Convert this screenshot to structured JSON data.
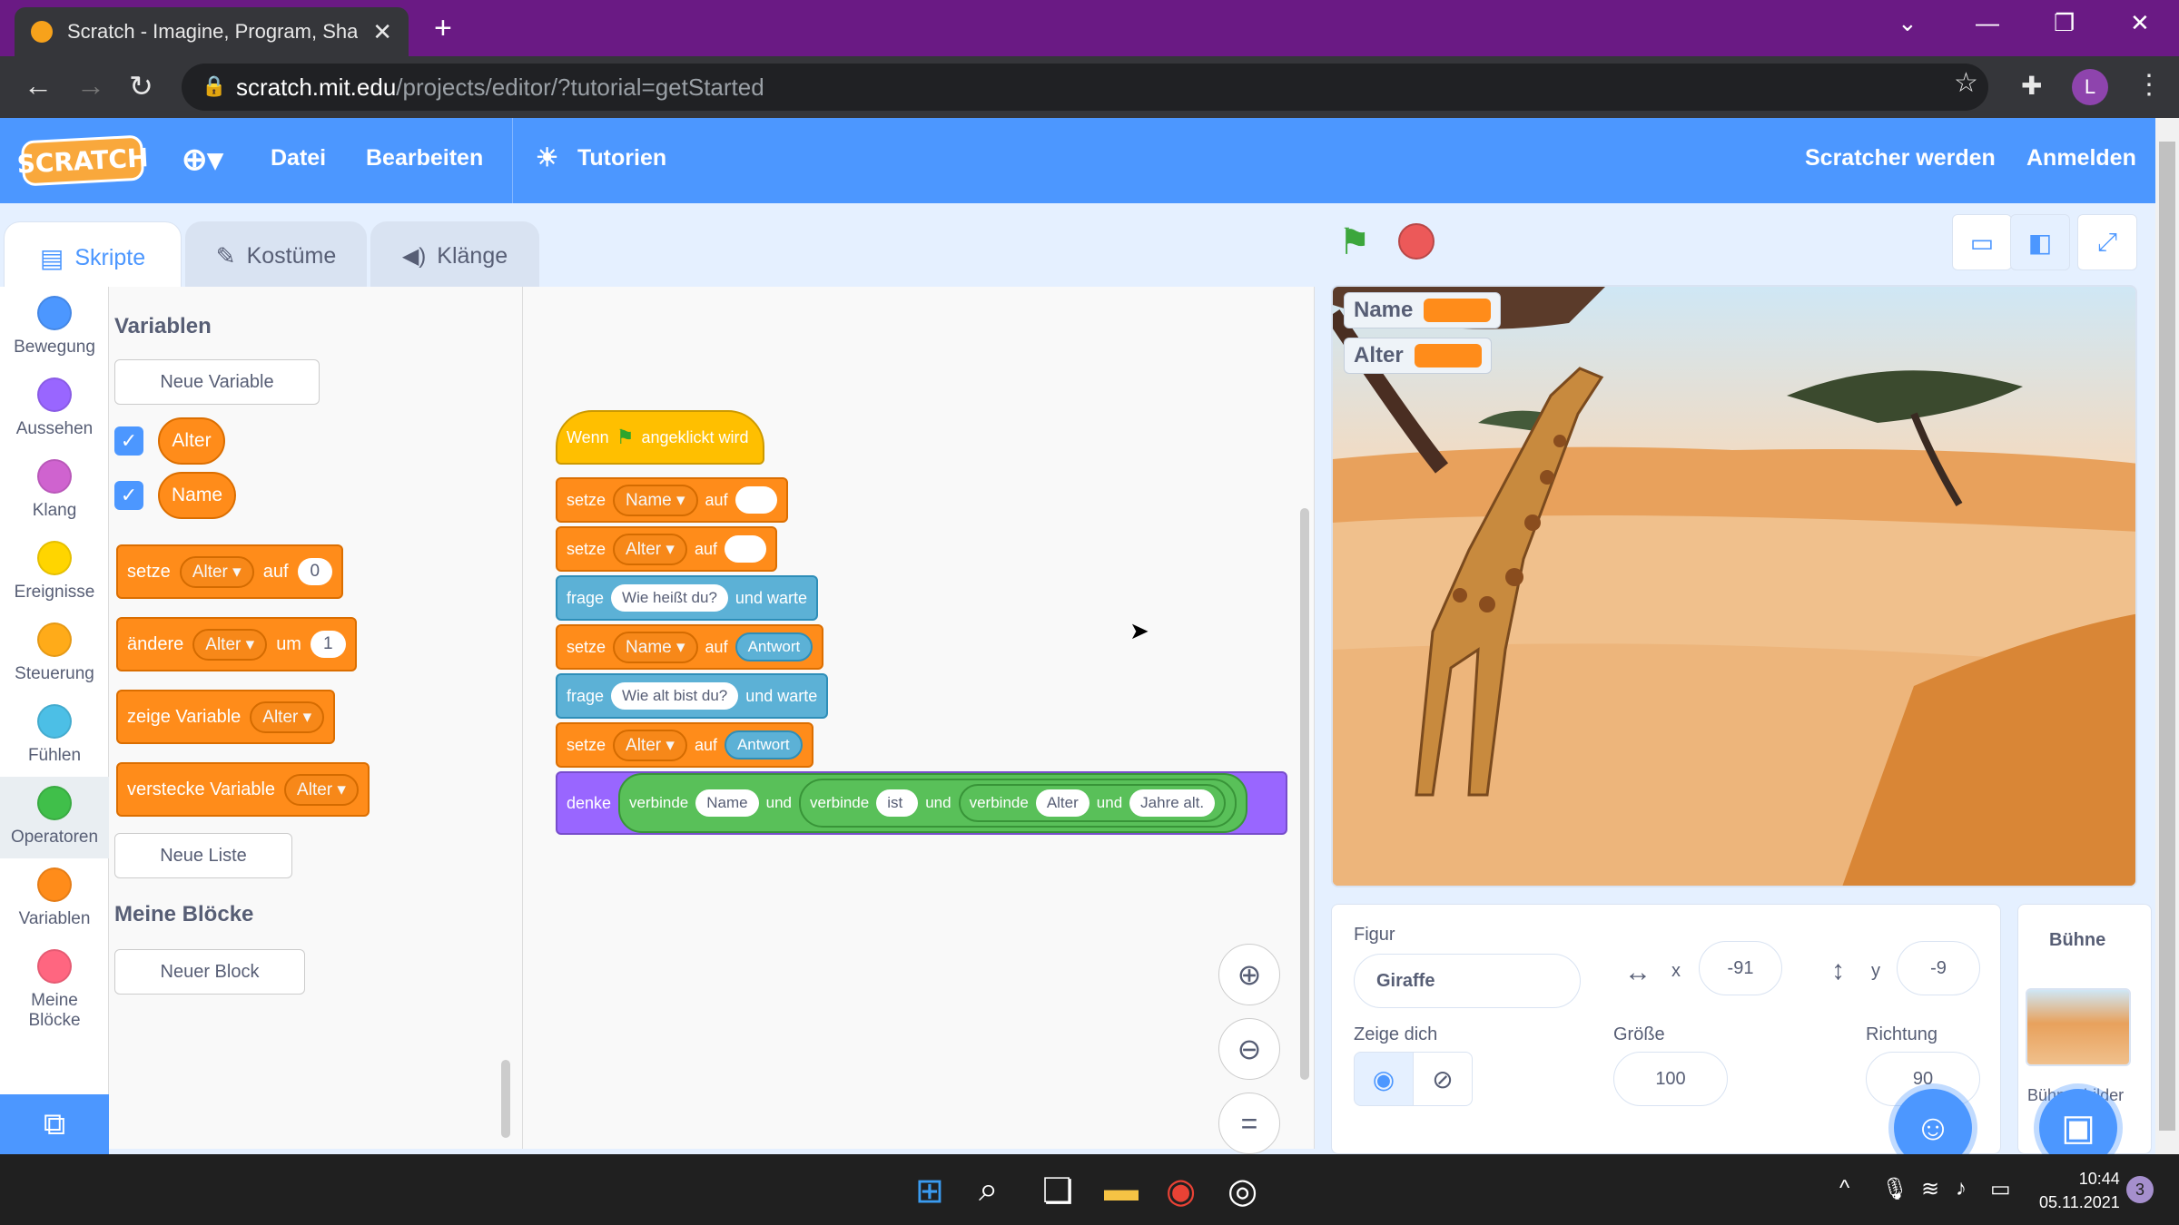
{
  "browser": {
    "tab_title": "Scratch - Imagine, Program, Shar",
    "tab_close": "✕",
    "new_tab": "+",
    "url_host": "scratch.mit.edu",
    "url_path": "/projects/editor/?tutorial=getStarted",
    "profile_initial": "L"
  },
  "menubar": {
    "logo": "SCRATCH",
    "file": "Datei",
    "edit": "Bearbeiten",
    "tutorials": "Tutorien",
    "join": "Scratcher werden",
    "signin": "Anmelden"
  },
  "editor_tabs": [
    "Skripte",
    "Kostüme",
    "Klänge"
  ],
  "categories": [
    {
      "label": "Bewegung",
      "color": "#4c97ff"
    },
    {
      "label": "Aussehen",
      "color": "#9966ff"
    },
    {
      "label": "Klang",
      "color": "#cf63cf"
    },
    {
      "label": "Ereignisse",
      "color": "#ffd500"
    },
    {
      "label": "Steuerung",
      "color": "#ffab19"
    },
    {
      "label": "Fühlen",
      "color": "#4cbfe6"
    },
    {
      "label": "Operatoren",
      "color": "#40bf4a"
    },
    {
      "label": "Variablen",
      "color": "#ff8c1a"
    },
    {
      "label": "Meine Blöcke",
      "color": "#ff6680"
    }
  ],
  "palette": {
    "heading_vars": "Variablen",
    "new_variable": "Neue Variable",
    "var1": "Alter",
    "var2": "Name",
    "set_label": "setze",
    "set_var": "Alter",
    "set_to": "auf",
    "set_value": "0",
    "change_label": "ändere",
    "change_var": "Alter",
    "change_by": "um",
    "change_value": "1",
    "show_label": "zeige Variable",
    "show_var": "Alter",
    "hide_label": "verstecke Variable",
    "hide_var": "Alter",
    "new_list": "Neue Liste",
    "heading_myblocks": "Meine Blöcke",
    "new_block": "Neuer Block"
  },
  "script": {
    "hat_when": "Wenn",
    "hat_clicked": "angeklickt wird",
    "b1_set": "setze",
    "b1_var": "Name",
    "b1_to": "auf",
    "b2_set": "setze",
    "b2_var": "Alter",
    "b2_to": "auf",
    "b3_ask": "frage",
    "b3_q": "Wie heißt du?",
    "b3_wait": "und warte",
    "b4_set": "setze",
    "b4_var": "Name",
    "b4_to": "auf",
    "b4_ans": "Antwort",
    "b5_ask": "frage",
    "b5_q": "Wie alt bist du?",
    "b5_wait": "und warte",
    "b6_set": "setze",
    "b6_var": "Alter",
    "b6_to": "auf",
    "b6_ans": "Antwort",
    "b7_think": "denke",
    "j1": "verbinde",
    "j1_a": "Name",
    "j1_und": "und",
    "j2": "verbinde",
    "j2_a": "ist",
    "j2_und": "und",
    "j3": "verbinde",
    "j3_a": "Alter",
    "j3_und": "und",
    "j3_b": "Jahre alt."
  },
  "stage": {
    "monitor1": "Name",
    "monitor2": "Alter"
  },
  "sprite_info": {
    "label_sprite": "Figur",
    "sprite_name": "Giraffe",
    "x_label": "x",
    "x_value": "-91",
    "y_label": "y",
    "y_value": "-9",
    "show_label": "Zeige dich",
    "size_label": "Größe",
    "size_value": "100",
    "direction_label": "Richtung",
    "direction_value": "90"
  },
  "stage_panel": {
    "title": "Bühne",
    "backdrops_label": "Bühnenbilder"
  },
  "taskbar": {
    "time": "10:44",
    "date": "05.11.2021",
    "notifications": "3"
  }
}
